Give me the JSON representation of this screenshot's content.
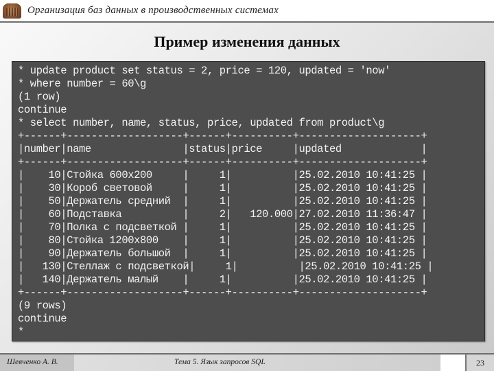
{
  "header": {
    "logo_icon": "building-logo-icon",
    "course_title": "Организация баз данных в производственных системах"
  },
  "slide": {
    "title": "Пример изменения данных"
  },
  "terminal": {
    "lines": [
      "* update product set status = 2, price = 120, updated = 'now'",
      "* where number = 60\\g",
      "(1 row)",
      "continue",
      "* select number, name, status, price, updated from product\\g",
      "+------+-------------------+------+----------+--------------------+",
      "|number|name               |status|price     |updated             |",
      "+------+-------------------+------+----------+--------------------+",
      "|    10|Стойка 600x200     |     1|          |25.02.2010 10:41:25 |",
      "|    30|Короб световой     |     1|          |25.02.2010 10:41:25 |",
      "|    50|Держатель средний  |     1|          |25.02.2010 10:41:25 |",
      "|    60|Подставка          |     2|   120.000|27.02.2010 11:36:47 |",
      "|    70|Полка с подсветкой |     1|          |25.02.2010 10:41:25 |",
      "|    80|Стойка 1200x800    |     1|          |25.02.2010 10:41:25 |",
      "|    90|Держатель большой  |     1|          |25.02.2010 10:41:25 |",
      "|   130|Стеллаж с подсветкой|     1|          |25.02.2010 10:41:25 |",
      "|   140|Держатель малый    |     1|          |25.02.2010 10:41:25 |",
      "+------+-------------------+------+----------+--------------------+",
      "(9 rows)",
      "continue",
      "*"
    ],
    "result_table": {
      "columns": [
        "number",
        "name",
        "status",
        "price",
        "updated"
      ],
      "rows": [
        [
          "10",
          "Стойка 600x200",
          "1",
          "",
          "25.02.2010 10:41:25"
        ],
        [
          "30",
          "Короб световой",
          "1",
          "",
          "25.02.2010 10:41:25"
        ],
        [
          "50",
          "Держатель средний",
          "1",
          "",
          "25.02.2010 10:41:25"
        ],
        [
          "60",
          "Подставка",
          "2",
          "120.000",
          "27.02.2010 11:36:47"
        ],
        [
          "70",
          "Полка с подсветкой",
          "1",
          "",
          "25.02.2010 10:41:25"
        ],
        [
          "80",
          "Стойка 1200x800",
          "1",
          "",
          "25.02.2010 10:41:25"
        ],
        [
          "90",
          "Держатель большой",
          "1",
          "",
          "25.02.2010 10:41:25"
        ],
        [
          "130",
          "Стеллаж с подсветкой",
          "1",
          "",
          "25.02.2010 10:41:25"
        ],
        [
          "140",
          "Держатель малый",
          "1",
          "",
          "25.02.2010 10:41:25"
        ]
      ]
    }
  },
  "footer": {
    "author": "Шевченко А. В.",
    "topic": "Тема 5. Язык запросов SQL",
    "page_number": "23"
  }
}
